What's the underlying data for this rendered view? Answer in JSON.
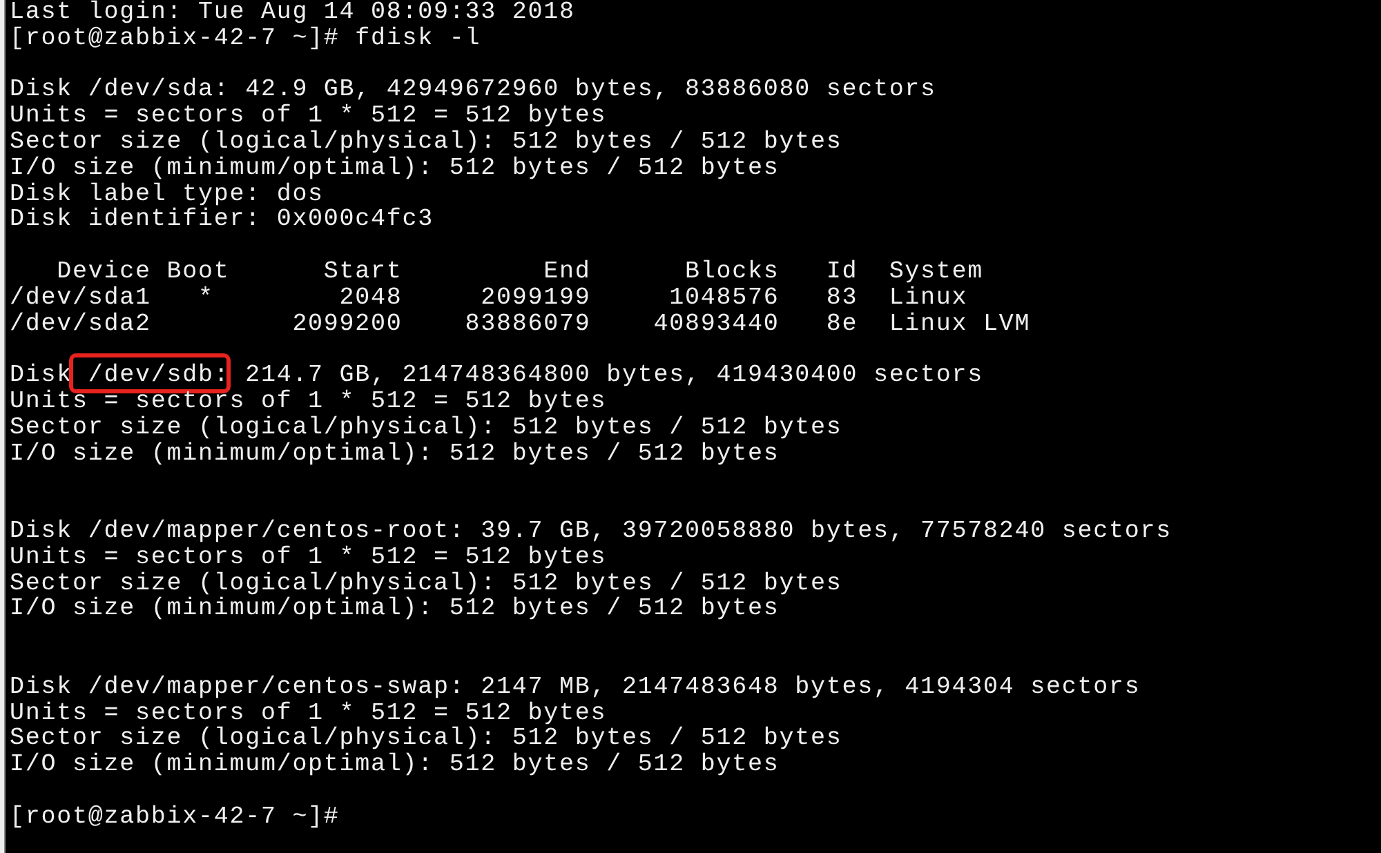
{
  "terminal": {
    "lines": [
      {
        "kind": "text",
        "text": "Last login: Tue Aug 14 08:09:33 2018"
      },
      {
        "kind": "prompt",
        "prompt": "[root@zabbix-42-7 ~]#",
        "command": "fdisk -l"
      },
      {
        "kind": "blank"
      },
      {
        "kind": "text",
        "text": "Disk /dev/sda: 42.9 GB, 42949672960 bytes, 83886080 sectors"
      },
      {
        "kind": "text",
        "text": "Units = sectors of 1 * 512 = 512 bytes"
      },
      {
        "kind": "text",
        "text": "Sector size (logical/physical): 512 bytes / 512 bytes"
      },
      {
        "kind": "text",
        "text": "I/O size (minimum/optimal): 512 bytes / 512 bytes"
      },
      {
        "kind": "text",
        "text": "Disk label type: dos"
      },
      {
        "kind": "text",
        "text": "Disk identifier: 0x000c4fc3"
      },
      {
        "kind": "blank"
      },
      {
        "kind": "text",
        "text": "   Device Boot      Start         End      Blocks   Id  System"
      },
      {
        "kind": "text",
        "text": "/dev/sda1   *        2048     2099199     1048576   83  Linux"
      },
      {
        "kind": "text",
        "text": "/dev/sda2         2099200    83886079    40893440   8e  Linux LVM"
      },
      {
        "kind": "blank"
      },
      {
        "kind": "text",
        "segments": [
          {
            "text": "Disk ",
            "highlighted": false
          },
          {
            "text": "/dev/sdb:",
            "highlighted": true
          },
          {
            "text": " 214.7 GB, 214748364800 bytes, 419430400 sectors",
            "highlighted": false
          }
        ]
      },
      {
        "kind": "text",
        "text": "Units = sectors of 1 * 512 = 512 bytes"
      },
      {
        "kind": "text",
        "text": "Sector size (logical/physical): 512 bytes / 512 bytes"
      },
      {
        "kind": "text",
        "text": "I/O size (minimum/optimal): 512 bytes / 512 bytes"
      },
      {
        "kind": "blank"
      },
      {
        "kind": "blank"
      },
      {
        "kind": "text",
        "text": "Disk /dev/mapper/centos-root: 39.7 GB, 39720058880 bytes, 77578240 sectors"
      },
      {
        "kind": "text",
        "text": "Units = sectors of 1 * 512 = 512 bytes"
      },
      {
        "kind": "text",
        "text": "Sector size (logical/physical): 512 bytes / 512 bytes"
      },
      {
        "kind": "text",
        "text": "I/O size (minimum/optimal): 512 bytes / 512 bytes"
      },
      {
        "kind": "blank"
      },
      {
        "kind": "blank"
      },
      {
        "kind": "text",
        "text": "Disk /dev/mapper/centos-swap: 2147 MB, 2147483648 bytes, 4194304 sectors"
      },
      {
        "kind": "text",
        "text": "Units = sectors of 1 * 512 = 512 bytes"
      },
      {
        "kind": "text",
        "text": "Sector size (logical/physical): 512 bytes / 512 bytes"
      },
      {
        "kind": "text",
        "text": "I/O size (minimum/optimal): 512 bytes / 512 bytes"
      },
      {
        "kind": "blank"
      },
      {
        "kind": "prompt",
        "prompt": "[root@zabbix-42-7 ~]#"
      }
    ]
  }
}
